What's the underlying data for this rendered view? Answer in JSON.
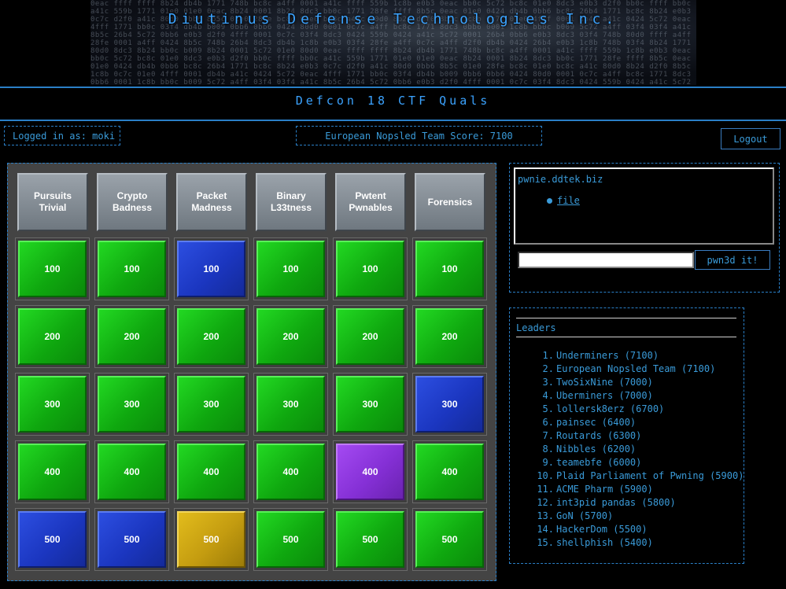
{
  "header": {
    "title": "Diutinus Defense Technologies Inc.",
    "subtitle": "Defcon 18 CTF Quals"
  },
  "status": {
    "logged_in": "Logged in as: moki",
    "team_score": "European Nopsled Team Score: 7100",
    "logout_label": "Logout"
  },
  "board": {
    "categories": [
      "Pursuits\nTrivial",
      "Crypto\nBadness",
      "Packet\nMadness",
      "Binary\nL33tness",
      "Pwtent\nPwnables",
      "Forensics"
    ],
    "rows": [
      {
        "value": "100",
        "states": [
          "green",
          "green",
          "blue",
          "green",
          "green",
          "green"
        ]
      },
      {
        "value": "200",
        "states": [
          "green",
          "green",
          "green",
          "green",
          "green",
          "green"
        ]
      },
      {
        "value": "300",
        "states": [
          "green",
          "green",
          "green",
          "green",
          "green",
          "blue"
        ]
      },
      {
        "value": "400",
        "states": [
          "green",
          "green",
          "green",
          "green",
          "purple",
          "green"
        ]
      },
      {
        "value": "500",
        "states": [
          "blue",
          "blue",
          "gold",
          "green",
          "green",
          "green"
        ]
      }
    ]
  },
  "pwnie": {
    "host": "pwnie.ddtek.biz",
    "file_label": "file",
    "input_value": "",
    "submit_label": "pwn3d it!"
  },
  "leaders": {
    "title": "Leaders",
    "entries": [
      {
        "rank": "1.",
        "text": "Underminers (7100)"
      },
      {
        "rank": "2.",
        "text": "European Nopsled Team (7100)"
      },
      {
        "rank": "3.",
        "text": "TwoSixNine (7000)"
      },
      {
        "rank": "4.",
        "text": "Uberminers (7000)"
      },
      {
        "rank": "5.",
        "text": "lollersk8erz (6700)"
      },
      {
        "rank": "6.",
        "text": "painsec (6400)"
      },
      {
        "rank": "7.",
        "text": "Routards (6300)"
      },
      {
        "rank": "8.",
        "text": "Nibbles (6200)"
      },
      {
        "rank": "9.",
        "text": "teamebfe (6000)"
      },
      {
        "rank": "10.",
        "text": "Plaid Parliament of Pwning (5900)"
      },
      {
        "rank": "11.",
        "text": "ACME Pharm (5900)"
      },
      {
        "rank": "12.",
        "text": "int3pid pandas (5800)"
      },
      {
        "rank": "13.",
        "text": "GoN (5700)"
      },
      {
        "rank": "14.",
        "text": "HackerDom (5500)"
      },
      {
        "rank": "15.",
        "text": "shellphish (5400)"
      }
    ]
  },
  "colors": {
    "accent": "#3a9bd9",
    "tile_green": "#14c014",
    "tile_blue": "#1f3fd0",
    "tile_purple": "#8a34d8",
    "tile_gold": "#d4aa12"
  }
}
